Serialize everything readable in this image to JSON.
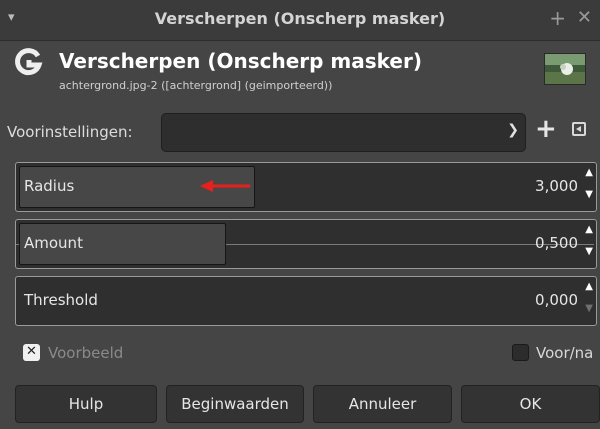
{
  "window": {
    "title": "Verscherpen (Onscherp masker)",
    "menu_glyph": "▾",
    "add_glyph": "+",
    "close_glyph": "✕"
  },
  "header": {
    "logo": "gimp-logo-icon",
    "title": "Verscherpen (Onscherp masker)",
    "subtitle": "achtergrond.jpg-2 ([achtergrond] (geimporteerd))",
    "thumbnail": "image-thumbnail"
  },
  "presets": {
    "label": "Voorinstellingen:",
    "value": "",
    "add_icon": "+",
    "menu_icon": "preset-menu-icon"
  },
  "params": [
    {
      "label": "Radius",
      "value": "3,000",
      "fill_fraction": 0.41
    },
    {
      "label": "Amount",
      "value": "0,500",
      "fill_fraction": 0.36
    },
    {
      "label": "Threshold",
      "value": "0,000",
      "fill_fraction": 0.0
    }
  ],
  "annotation": {
    "color": "#e8201c"
  },
  "preview": {
    "label": "Voorbeeld",
    "checked": true
  },
  "split": {
    "label": "Voor/na",
    "checked": false
  },
  "buttons": {
    "help": "Hulp",
    "reset": "Beginwaarden",
    "cancel": "Annuleer",
    "ok": "OK"
  }
}
